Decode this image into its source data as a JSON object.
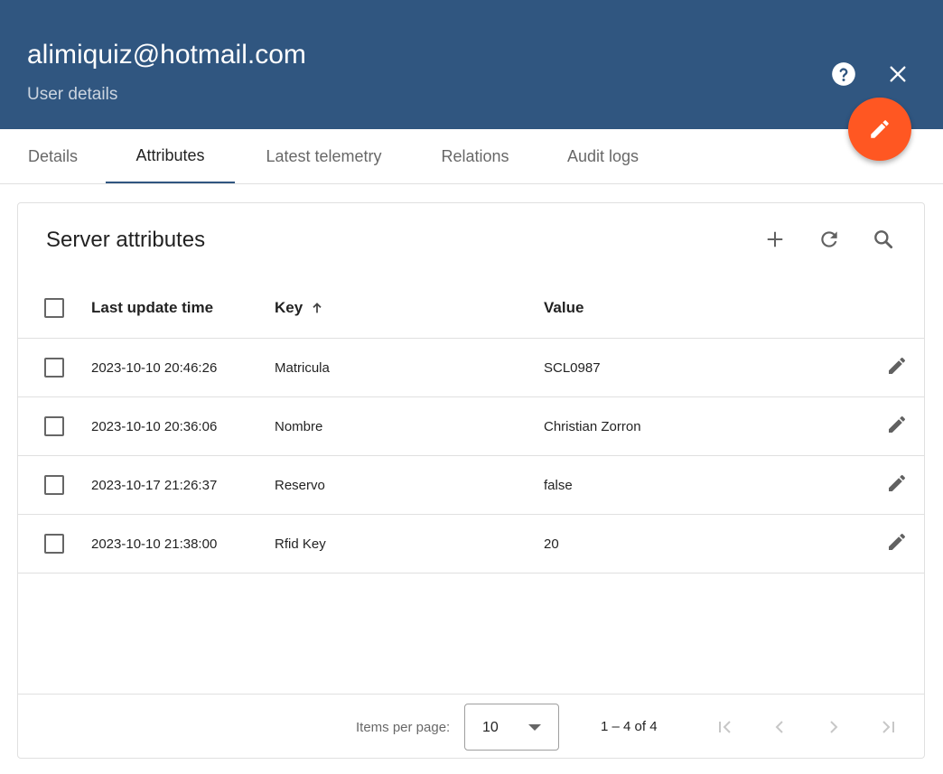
{
  "header": {
    "title": "alimiquiz@hotmail.com",
    "subtitle": "User details",
    "background_color": "#305680",
    "help_icon": "help-circle-icon",
    "close_icon": "close-icon"
  },
  "fab": {
    "icon": "pencil-icon",
    "color": "#ff5722"
  },
  "tabs": [
    {
      "label": "Details",
      "active": false
    },
    {
      "label": "Attributes",
      "active": true
    },
    {
      "label": "Latest telemetry",
      "active": false
    },
    {
      "label": "Relations",
      "active": false
    },
    {
      "label": "Audit logs",
      "active": false
    }
  ],
  "attributes": {
    "title": "Server attributes",
    "toolbar": {
      "add_icon": "plus-icon",
      "refresh_icon": "refresh-icon",
      "search_icon": "search-icon"
    },
    "columns": {
      "time": "Last update time",
      "key": "Key",
      "key_sort_icon": "arrow-up-icon",
      "value": "Value"
    },
    "rows": [
      {
        "time": "2023-10-10 20:46:26",
        "key": "Matricula",
        "value": "SCL0987"
      },
      {
        "time": "2023-10-10 20:36:06",
        "key": "Nombre",
        "value": "Christian Zorron"
      },
      {
        "time": "2023-10-17 21:26:37",
        "key": "Reservo",
        "value": "false"
      },
      {
        "time": "2023-10-10 21:38:00",
        "key": "Rfid Key",
        "value": "20"
      }
    ]
  },
  "paginator": {
    "items_per_page_label": "Items per page:",
    "items_per_page_value": "10",
    "range_label": "1 – 4 of 4",
    "icons": [
      "first-page-icon",
      "previous-page-icon",
      "next-page-icon",
      "last-page-icon"
    ]
  }
}
